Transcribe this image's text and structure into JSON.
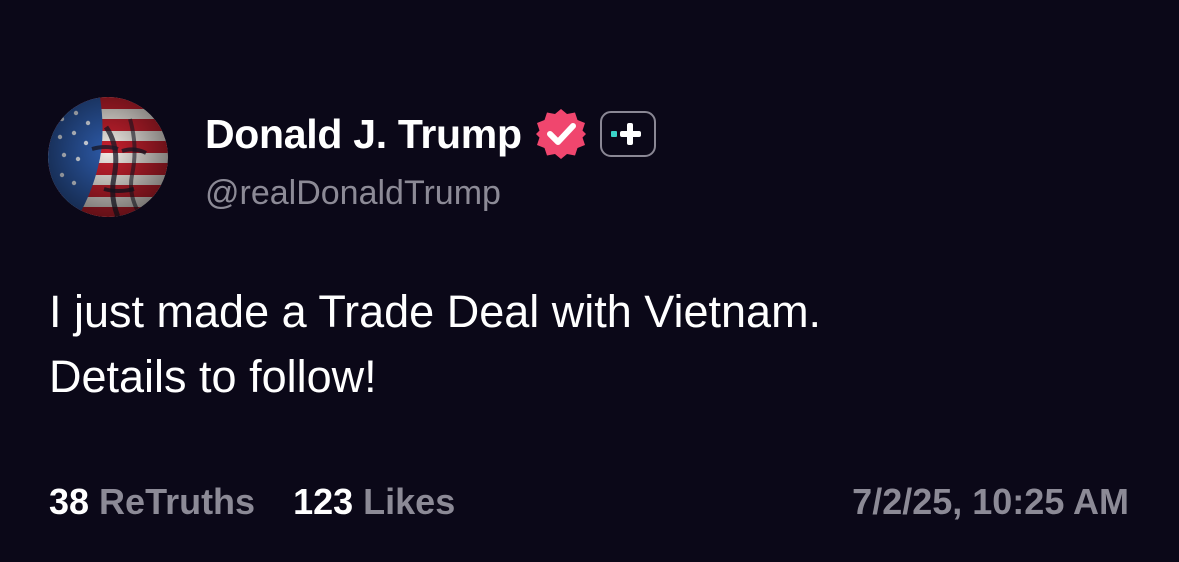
{
  "post": {
    "author": {
      "display_name": "Donald J. Trump",
      "handle": "@realDonaldTrump",
      "verified_icon": "verified-badge-icon",
      "plus_icon": "truth-plus-icon"
    },
    "text_lines": [
      "I just made a Trade Deal with Vietnam.",
      "Details to follow!"
    ],
    "stats": {
      "retruths_count": "38",
      "retruths_label": "ReTruths",
      "likes_count": "123",
      "likes_label": "Likes"
    },
    "timestamp": "7/2/25, 10:25 AM"
  },
  "colors": {
    "background": "#0b0818",
    "text_primary": "#ffffff",
    "text_secondary": "#8c8a96",
    "verified_pink": "#f0466e",
    "plus_accent": "#3ad3c8"
  }
}
